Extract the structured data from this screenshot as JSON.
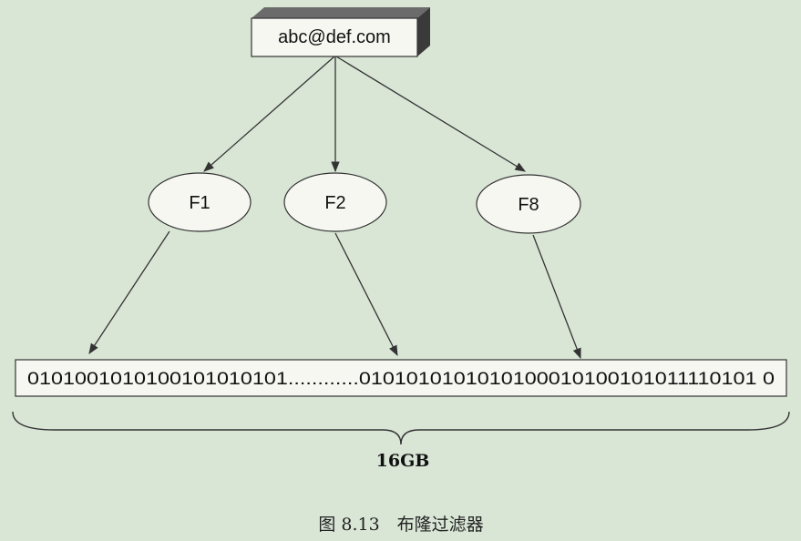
{
  "email": "abc@def.com",
  "hash_functions": [
    "F1",
    "F2",
    "F8"
  ],
  "bit_array": "0101001010100101010101............0101010101010100010100101011110101 0",
  "size_label": "16GB",
  "caption": "图 8.13　布隆过滤器"
}
